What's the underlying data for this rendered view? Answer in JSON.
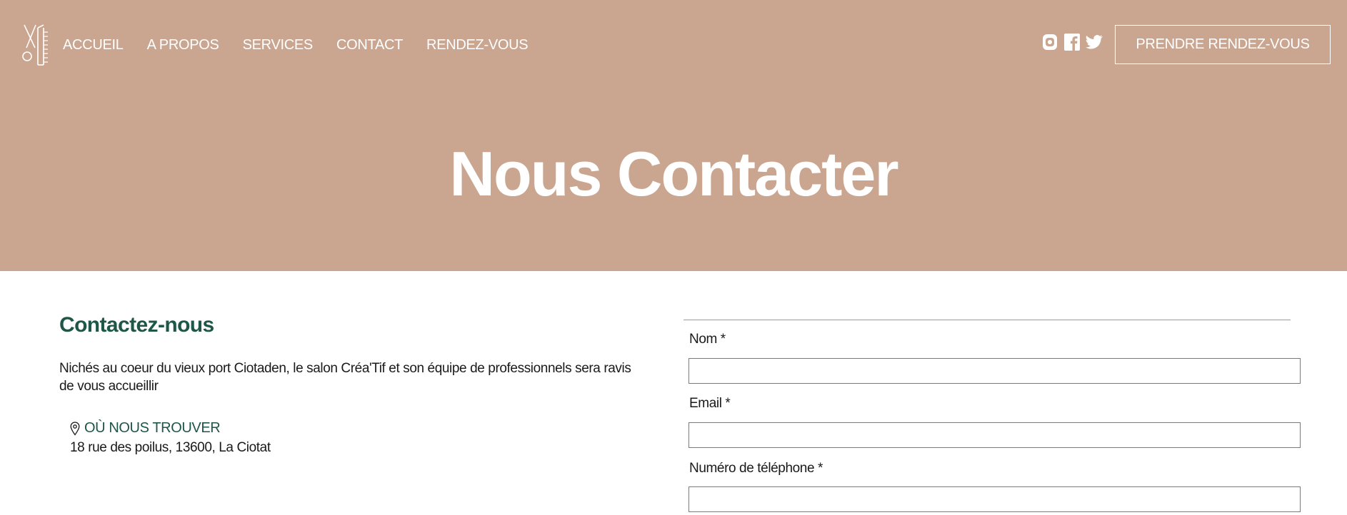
{
  "header": {
    "nav": [
      "ACCUEIL",
      "A PROPOS",
      "SERVICES",
      "CONTACT",
      "RENDEZ-VOUS"
    ],
    "social_icons": [
      "instagram-icon",
      "facebook-icon",
      "twitter-icon"
    ],
    "cta_label": "PRENDRE RENDEZ-VOUS"
  },
  "hero": {
    "title": "Nous Contacter"
  },
  "contact": {
    "heading": "Contactez-nous",
    "description": "Nichés au coeur du vieux port Ciotaden, le salon Créa'Tif et son équipe de professionnels sera ravis de vous accueillir",
    "location_label": "OÙ NOUS TROUVER",
    "address": "18 rue des poilus, 13600, La Ciotat"
  },
  "form": {
    "name_label": "Nom *",
    "name_value": "",
    "email_label": "Email *",
    "email_value": "",
    "phone_label": "Numéro de téléphone *",
    "phone_value": ""
  },
  "colors": {
    "hero_bg": "#caa590",
    "accent_green": "#1e5647",
    "text": "#1a1a1a"
  }
}
